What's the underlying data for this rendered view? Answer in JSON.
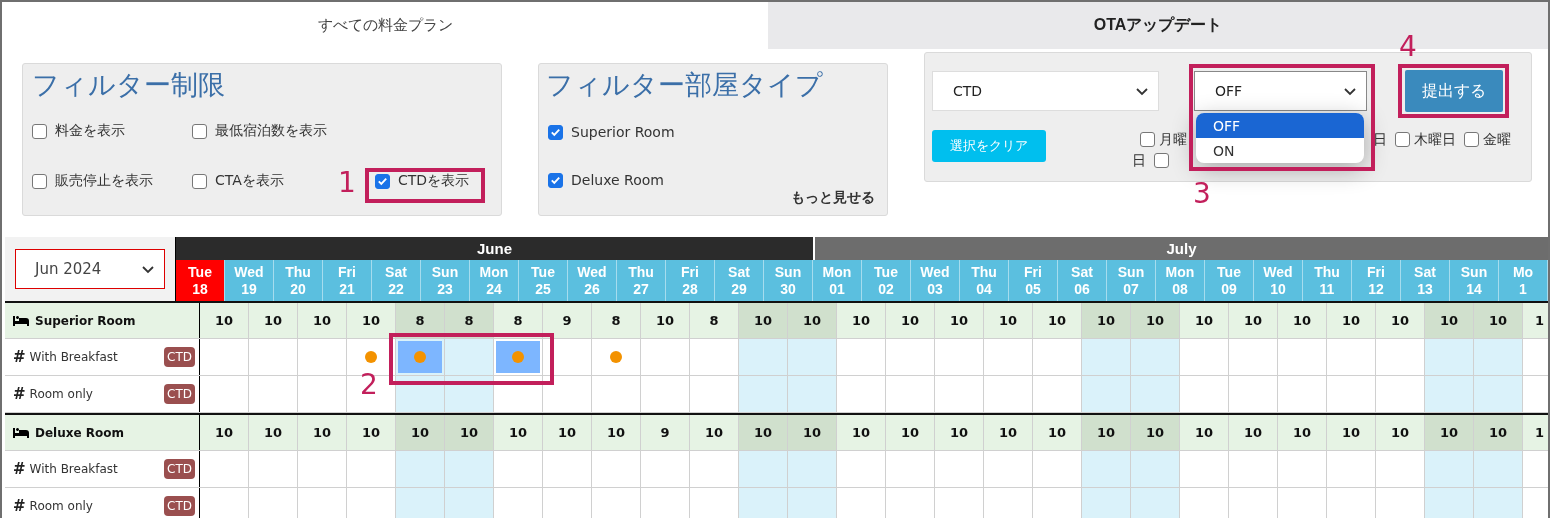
{
  "tabs": [
    {
      "label": "すべての料金プラン",
      "selected": true
    },
    {
      "label": "OTAアップデート",
      "selected": false
    }
  ],
  "filter_restrictions": {
    "title": "フィルター制限",
    "options": [
      {
        "label": "料金を表示",
        "checked": false
      },
      {
        "label": "最低宿泊数を表示",
        "checked": false
      },
      {
        "label": "販売停止を表示",
        "checked": false
      },
      {
        "label": "CTAを表示",
        "checked": false
      },
      {
        "label": "CTDを表示",
        "checked": true
      }
    ]
  },
  "filter_room_types": {
    "title": "フィルター部屋タイプ",
    "options": [
      {
        "label": "Superior Room",
        "checked": true
      },
      {
        "label": "Deluxe Room",
        "checked": true
      }
    ],
    "more_link": "もっと見せる"
  },
  "update_panel": {
    "restriction_select": "CTD",
    "value_select": {
      "value": "OFF",
      "expanded": true,
      "options": [
        {
          "label": "OFF",
          "selected": true
        },
        {
          "label": "ON",
          "selected": false
        }
      ]
    },
    "submit_button": "提出する",
    "clear_button": "選択をクリア",
    "weekday_lines": [
      [
        {
          "kind": "checkbox",
          "label": "月曜",
          "checked": false
        },
        {
          "kind": "text",
          "label": "日"
        },
        {
          "kind": "checkbox",
          "label": "木曜日",
          "checked": false
        },
        {
          "kind": "checkbox",
          "label": "金曜",
          "checked": false
        }
      ],
      [
        {
          "kind": "text",
          "label": "日"
        },
        {
          "kind": "checkbox",
          "checked": false
        }
      ]
    ]
  },
  "calendar": {
    "month_select": "Jun 2024",
    "months": [
      {
        "label": "June",
        "days": [
          {
            "dow": "Tue",
            "day": "18",
            "today": true,
            "weekend": false
          },
          {
            "dow": "Wed",
            "day": "19",
            "today": false,
            "weekend": false
          },
          {
            "dow": "Thu",
            "day": "20",
            "today": false,
            "weekend": false
          },
          {
            "dow": "Fri",
            "day": "21",
            "today": false,
            "weekend": false
          },
          {
            "dow": "Sat",
            "day": "22",
            "today": false,
            "weekend": true
          },
          {
            "dow": "Sun",
            "day": "23",
            "today": false,
            "weekend": true
          },
          {
            "dow": "Mon",
            "day": "24",
            "today": false,
            "weekend": false
          },
          {
            "dow": "Tue",
            "day": "25",
            "today": false,
            "weekend": false
          },
          {
            "dow": "Wed",
            "day": "26",
            "today": false,
            "weekend": false
          },
          {
            "dow": "Thu",
            "day": "27",
            "today": false,
            "weekend": false
          },
          {
            "dow": "Fri",
            "day": "28",
            "today": false,
            "weekend": false
          },
          {
            "dow": "Sat",
            "day": "29",
            "today": false,
            "weekend": true
          },
          {
            "dow": "Sun",
            "day": "30",
            "today": false,
            "weekend": true
          }
        ]
      },
      {
        "label": "July",
        "days": [
          {
            "dow": "Mon",
            "day": "01",
            "today": false,
            "weekend": false
          },
          {
            "dow": "Tue",
            "day": "02",
            "today": false,
            "weekend": false
          },
          {
            "dow": "Wed",
            "day": "03",
            "today": false,
            "weekend": false
          },
          {
            "dow": "Thu",
            "day": "04",
            "today": false,
            "weekend": false
          },
          {
            "dow": "Fri",
            "day": "05",
            "today": false,
            "weekend": false
          },
          {
            "dow": "Sat",
            "day": "06",
            "today": false,
            "weekend": true
          },
          {
            "dow": "Sun",
            "day": "07",
            "today": false,
            "weekend": true
          },
          {
            "dow": "Mon",
            "day": "08",
            "today": false,
            "weekend": false
          },
          {
            "dow": "Tue",
            "day": "09",
            "today": false,
            "weekend": false
          },
          {
            "dow": "Wed",
            "day": "10",
            "today": false,
            "weekend": false
          },
          {
            "dow": "Thu",
            "day": "11",
            "today": false,
            "weekend": false
          },
          {
            "dow": "Fri",
            "day": "12",
            "today": false,
            "weekend": false
          },
          {
            "dow": "Sat",
            "day": "13",
            "today": false,
            "weekend": true
          },
          {
            "dow": "Sun",
            "day": "14",
            "today": false,
            "weekend": true
          },
          {
            "dow": "Mo",
            "day": "1",
            "today": false,
            "weekend": false
          }
        ]
      }
    ],
    "rooms": [
      {
        "name": "Superior Room",
        "availability": [
          "10",
          "10",
          "10",
          "10",
          "8",
          "8",
          "8",
          "9",
          "8",
          "10",
          "8",
          "10",
          "10",
          "10",
          "10",
          "10",
          "10",
          "10",
          "10",
          "10",
          "10",
          "10",
          "10",
          "10",
          "10",
          "10",
          "10",
          "1"
        ],
        "plans": [
          {
            "marker": "#",
            "name": "With Breakfast",
            "badge": "CTD",
            "ctd": [
              false,
              false,
              false,
              true,
              true,
              false,
              true,
              false,
              true,
              false,
              false,
              false,
              false,
              false,
              false,
              false,
              false,
              false,
              false,
              false,
              false,
              false,
              false,
              false,
              false,
              false,
              false
            ],
            "selected": [
              false,
              false,
              false,
              false,
              true,
              false,
              true,
              false,
              false,
              false,
              false,
              false,
              false,
              false,
              false,
              false,
              false,
              false,
              false,
              false,
              false,
              false,
              false,
              false,
              false,
              false,
              false
            ]
          },
          {
            "marker": "#",
            "name": "Room only",
            "badge": "CTD",
            "ctd": [
              false,
              false,
              false,
              false,
              false,
              false,
              false,
              false,
              false,
              false,
              false,
              false,
              false,
              false,
              false,
              false,
              false,
              false,
              false,
              false,
              false,
              false,
              false,
              false,
              false,
              false,
              false
            ],
            "selected": [
              false,
              false,
              false,
              false,
              false,
              false,
              false,
              false,
              false,
              false,
              false,
              false,
              false,
              false,
              false,
              false,
              false,
              false,
              false,
              false,
              false,
              false,
              false,
              false,
              false,
              false,
              false
            ]
          }
        ]
      },
      {
        "name": "Deluxe Room",
        "availability": [
          "10",
          "10",
          "10",
          "10",
          "10",
          "10",
          "10",
          "10",
          "10",
          "9",
          "10",
          "10",
          "10",
          "10",
          "10",
          "10",
          "10",
          "10",
          "10",
          "10",
          "10",
          "10",
          "10",
          "10",
          "10",
          "10",
          "10",
          "1"
        ],
        "plans": [
          {
            "marker": "#",
            "name": "With Breakfast",
            "badge": "CTD",
            "ctd": [
              false,
              false,
              false,
              false,
              false,
              false,
              false,
              false,
              false,
              false,
              false,
              false,
              false,
              false,
              false,
              false,
              false,
              false,
              false,
              false,
              false,
              false,
              false,
              false,
              false,
              false,
              false
            ],
            "selected": [
              false,
              false,
              false,
              false,
              false,
              false,
              false,
              false,
              false,
              false,
              false,
              false,
              false,
              false,
              false,
              false,
              false,
              false,
              false,
              false,
              false,
              false,
              false,
              false,
              false,
              false,
              false
            ]
          },
          {
            "marker": "#",
            "name": "Room only",
            "badge": "CTD",
            "ctd": [
              false,
              false,
              false,
              false,
              false,
              false,
              false,
              false,
              false,
              false,
              false,
              false,
              false,
              false,
              false,
              false,
              false,
              false,
              false,
              false,
              false,
              false,
              false,
              false,
              false,
              false,
              false
            ],
            "selected": [
              false,
              false,
              false,
              false,
              false,
              false,
              false,
              false,
              false,
              false,
              false,
              false,
              false,
              false,
              false,
              false,
              false,
              false,
              false,
              false,
              false,
              false,
              false,
              false,
              false,
              false,
              false
            ]
          }
        ]
      }
    ]
  },
  "annotations": [
    {
      "label": "1"
    },
    {
      "label": "2"
    },
    {
      "label": "3"
    },
    {
      "label": "4"
    }
  ]
}
